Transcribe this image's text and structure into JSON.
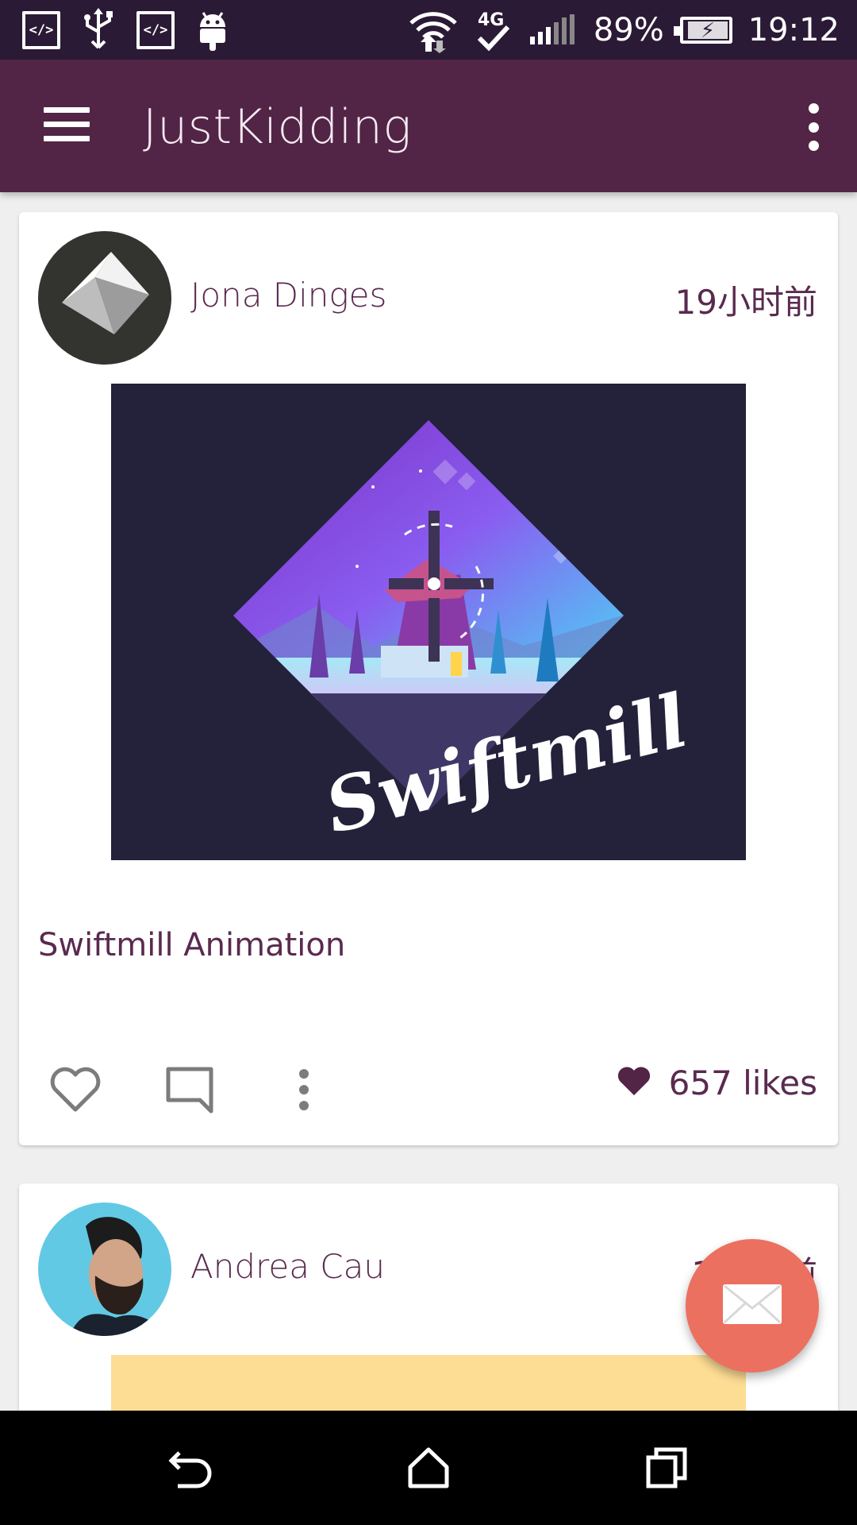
{
  "status_bar": {
    "battery_percent": "89%",
    "time": "19:12",
    "network_type": "4G",
    "icons": [
      "code-icon",
      "usb-icon",
      "code-icon",
      "android-icon",
      "wifi-icon",
      "4g-icon",
      "signal-icon",
      "battery-charging-icon"
    ]
  },
  "app_bar": {
    "title": "JustKidding",
    "menu_icon": "hamburger-menu-icon",
    "overflow_icon": "more-vert-icon",
    "color": "#522446"
  },
  "feed": [
    {
      "author": "Jona Dinges",
      "time": "19小时前",
      "image_text": "Swiftmill",
      "caption": "Swiftmill Animation",
      "likes": "657 likes"
    },
    {
      "author": "Andrea Cau",
      "time": "1",
      "time_tail": "前"
    }
  ],
  "fab": {
    "icon": "mail-icon",
    "color": "#ec7060"
  },
  "nav_bar": {
    "icons": [
      "back-icon",
      "home-icon",
      "recents-icon"
    ]
  }
}
